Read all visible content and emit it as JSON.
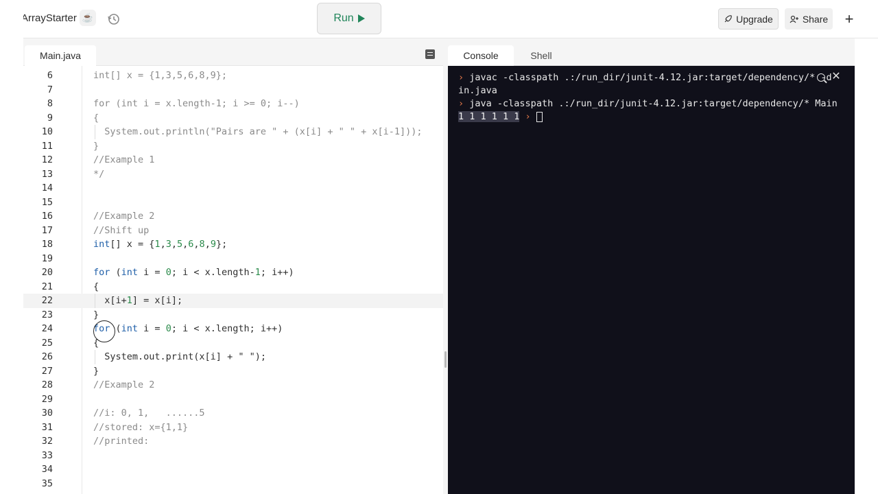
{
  "header": {
    "app_title": "ArrayStarter",
    "run_label": "Run",
    "upgrade_label": "Upgrade",
    "share_label": "Share",
    "plus_label": "+"
  },
  "editor": {
    "file_tab": "Main.java",
    "lines": [
      {
        "n": "6",
        "text": "int[] x = {1,3,5,6,8,9};",
        "comment": true
      },
      {
        "n": "7",
        "text": "",
        "comment": true
      },
      {
        "n": "8",
        "text": "for (int i = x.length-1; i >= 0; i--)",
        "comment": true
      },
      {
        "n": "9",
        "text": "{",
        "comment": true
      },
      {
        "n": "10",
        "text": "  System.out.println(\"Pairs are \" + (x[i] + \" \" + x[i-1]));",
        "comment": true
      },
      {
        "n": "11",
        "text": "}",
        "comment": true
      },
      {
        "n": "12",
        "text": "//Example 1",
        "comment": true
      },
      {
        "n": "13",
        "text": "*/",
        "comment": true
      },
      {
        "n": "14",
        "text": "",
        "comment": false
      },
      {
        "n": "15",
        "text": "",
        "comment": false
      },
      {
        "n": "16",
        "text": "//Example 2",
        "comment": true
      },
      {
        "n": "17",
        "text": "//Shift up",
        "comment": true
      },
      {
        "n": "18",
        "text": "int[] x = {1,3,5,6,8,9};",
        "comment": false
      },
      {
        "n": "19",
        "text": "",
        "comment": false
      },
      {
        "n": "20",
        "text": "for (int i = 0; i < x.length-1; i++)",
        "comment": false
      },
      {
        "n": "21",
        "text": "{",
        "comment": false
      },
      {
        "n": "22",
        "text": "  x[i+1] = x[i];",
        "comment": false
      },
      {
        "n": "23",
        "text": "}",
        "comment": false
      },
      {
        "n": "24",
        "text": "for (int i = 0; i < x.length; i++)",
        "comment": false
      },
      {
        "n": "25",
        "text": "{",
        "comment": false
      },
      {
        "n": "26",
        "text": "  System.out.print(x[i] + \" \");",
        "comment": false
      },
      {
        "n": "27",
        "text": "}",
        "comment": false
      },
      {
        "n": "28",
        "text": "//Example 2",
        "comment": true
      },
      {
        "n": "29",
        "text": "",
        "comment": false
      },
      {
        "n": "30",
        "text": "//i: 0, 1,   ......5",
        "comment": true
      },
      {
        "n": "31",
        "text": "//stored: x={1,1}",
        "comment": true
      },
      {
        "n": "32",
        "text": "//printed:",
        "comment": true
      },
      {
        "n": "33",
        "text": "",
        "comment": false
      },
      {
        "n": "34",
        "text": "",
        "comment": false
      },
      {
        "n": "35",
        "text": "",
        "comment": false
      }
    ],
    "active_line": "22"
  },
  "console": {
    "tab_console": "Console",
    "tab_shell": "Shell",
    "prompt_symbol": "›",
    "line1": "javac -classpath .:/run_dir/junit-4.12.jar:target/dependency/* -d",
    "line1_wrap": "in.java",
    "line2": "java -classpath .:/run_dir/junit-4.12.jar:target/dependency/* Main",
    "output": "1 1 1 1 1 1"
  }
}
